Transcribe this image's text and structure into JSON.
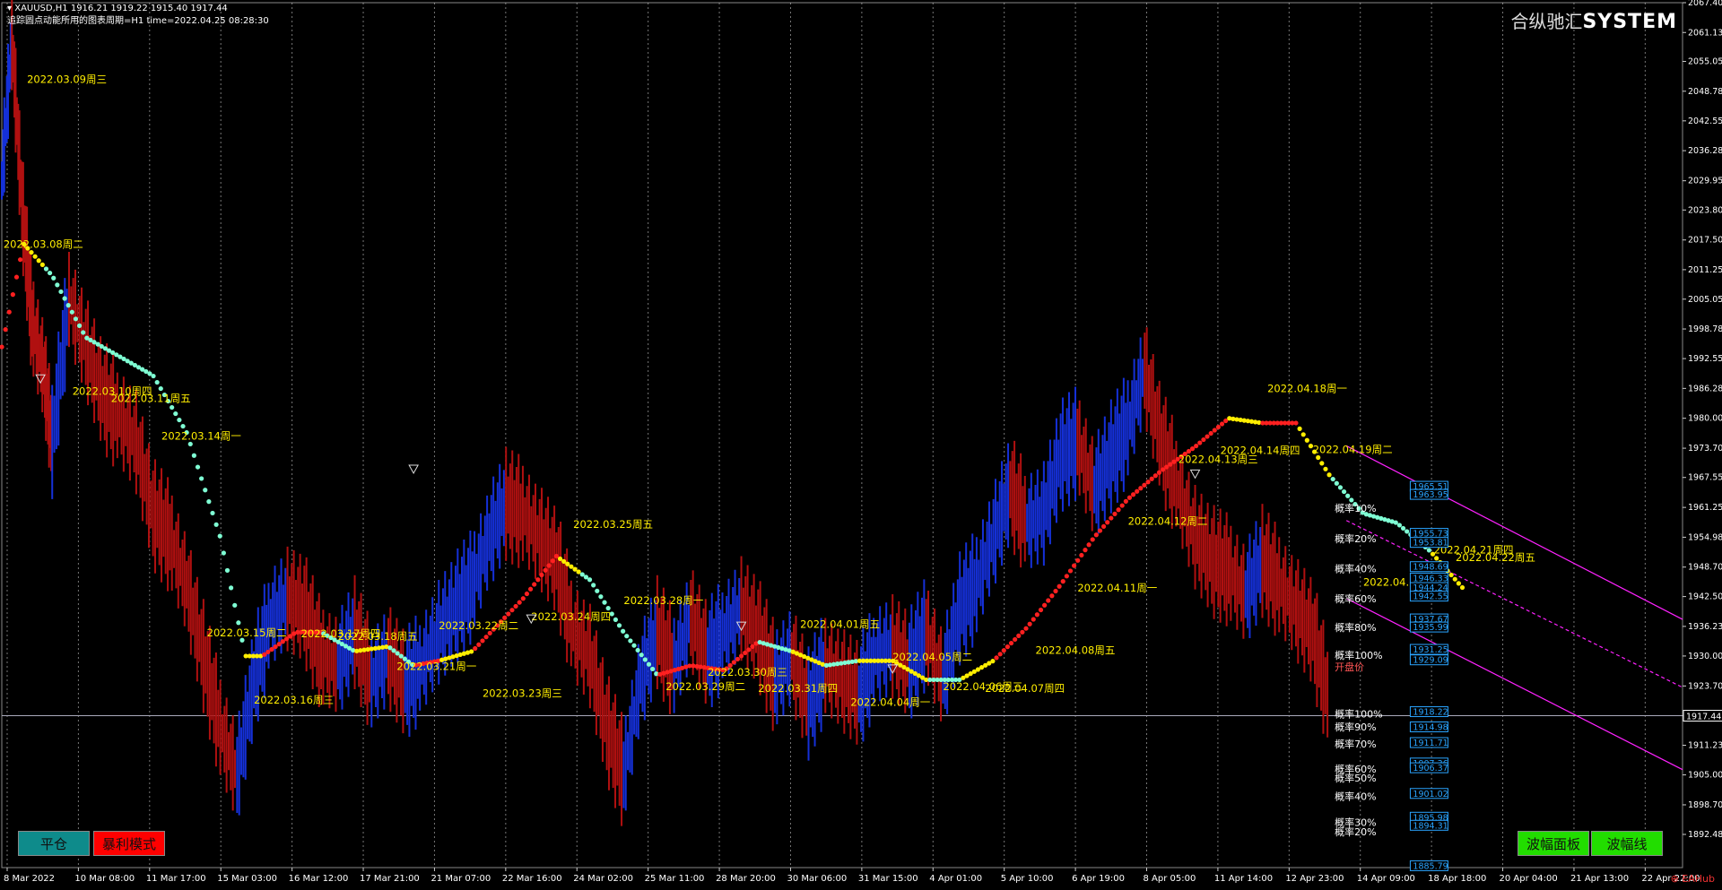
{
  "header": {
    "symbol_line": "XAUUSD,H1  1916.21 1919.22 1915.40 1917.44",
    "info_line": "追踪圆点动能所用的图表周期=H1  time=2022.04.25 08:28:30"
  },
  "brand": {
    "cn": "合纵驰汇",
    "en": "SYSTEM"
  },
  "buttons": {
    "close_position": "平仓",
    "profit_mode": "暴利模式",
    "amplitude_panel": "波幅面板",
    "amplitude_line": "波幅线"
  },
  "watermark": "EAHub",
  "chart_data": {
    "type": "line",
    "ylim": [
      1885.5,
      2067.4
    ],
    "current_price": 1917.44,
    "y_ticks": [
      2067.4,
      2061.13,
      2055.05,
      2048.78,
      2042.55,
      2036.28,
      2029.95,
      2023.8,
      2017.5,
      2011.25,
      2005.05,
      1998.78,
      1992.55,
      1986.28,
      1980.0,
      1973.7,
      1967.55,
      1961.25,
      1954.98,
      1948.7,
      1942.5,
      1936.23,
      1930.0,
      1923.7,
      1917.44,
      1911.23,
      1905.0,
      1898.7,
      1892.48
    ],
    "x_labels": [
      "8 Mar 2022",
      "10 Mar 08:00",
      "11 Mar 17:00",
      "15 Mar 03:00",
      "16 Mar 12:00",
      "17 Mar 21:00",
      "21 Mar 07:00",
      "22 Mar 16:00",
      "24 Mar 02:00",
      "25 Mar 11:00",
      "28 Mar 20:00",
      "30 Mar 06:00",
      "31 Mar 15:00",
      "4 Apr 01:00",
      "5 Apr 10:00",
      "6 Apr 19:00",
      "8 Apr 05:00",
      "11 Apr 14:00",
      "12 Apr 23:00",
      "14 Apr 09:00",
      "18 Apr 18:00",
      "20 Apr 04:00",
      "21 Apr 13:00",
      "22 Apr 22:00"
    ],
    "date_labels": [
      {
        "t": "2022.03.09周三",
        "x": 1.5,
        "y": 2050.5
      },
      {
        "t": "2022.03.08周二",
        "x": 0.1,
        "y": 2015.8
      },
      {
        "t": "2022.03.10周四",
        "x": 4.2,
        "y": 1984.9
      },
      {
        "t": "2022.03.11周五",
        "x": 6.5,
        "y": 1983.4
      },
      {
        "t": "2022.03.14周一",
        "x": 9.5,
        "y": 1975.5
      },
      {
        "t": "2022.03.15周二",
        "x": 12.2,
        "y": 1934.1
      },
      {
        "t": "2022.03.16周三",
        "x": 15.0,
        "y": 1920.0
      },
      {
        "t": "2022.03.17周四",
        "x": 17.8,
        "y": 1933.9
      },
      {
        "t": "2022.03.18周五",
        "x": 20.0,
        "y": 1933.4
      },
      {
        "t": "2022.03.21周一",
        "x": 23.5,
        "y": 1927.1
      },
      {
        "t": "2022.03.22周二",
        "x": 26.0,
        "y": 1935.6
      },
      {
        "t": "2022.03.23周三",
        "x": 28.6,
        "y": 1921.4
      },
      {
        "t": "2022.03.24周四",
        "x": 31.5,
        "y": 1937.5
      },
      {
        "t": "2022.03.25周五",
        "x": 34.0,
        "y": 1956.9
      },
      {
        "t": "2022.03.28周一",
        "x": 37.0,
        "y": 1940.9
      },
      {
        "t": "2022.03.29周二",
        "x": 39.5,
        "y": 1922.8
      },
      {
        "t": "2022.03.30周三",
        "x": 42.0,
        "y": 1925.8
      },
      {
        "t": "2022.03.31周四",
        "x": 45.0,
        "y": 1922.4
      },
      {
        "t": "2022.04.01周五",
        "x": 47.5,
        "y": 1935.9
      },
      {
        "t": "2022.04.04周一",
        "x": 50.5,
        "y": 1919.5
      },
      {
        "t": "2022.04.05周二",
        "x": 53.0,
        "y": 1929.0
      },
      {
        "t": "2022.04.06周三",
        "x": 56.0,
        "y": 1922.8
      },
      {
        "t": "2022.04.07周四",
        "x": 58.5,
        "y": 1922.4
      },
      {
        "t": "2022.04.08周五",
        "x": 61.5,
        "y": 1930.5
      },
      {
        "t": "2022.04.11周一",
        "x": 64.0,
        "y": 1943.6
      },
      {
        "t": "2022.04.12周二",
        "x": 67.0,
        "y": 1957.6
      },
      {
        "t": "2022.04.13周三",
        "x": 70.0,
        "y": 1970.6
      },
      {
        "t": "2022.04.14周四",
        "x": 72.5,
        "y": 1972.5
      },
      {
        "t": "2022.04.18周一",
        "x": 75.3,
        "y": 1985.5
      },
      {
        "t": "2022.04.19周二",
        "x": 78.0,
        "y": 1972.7
      },
      {
        "t": "2022.04.20周三",
        "x": 81.0,
        "y": 1944.8
      },
      {
        "t": "2022.04.21周四",
        "x": 85.2,
        "y": 1951.6
      },
      {
        "t": "2022.04.22周五",
        "x": 86.5,
        "y": 1950.0
      }
    ],
    "level_labels": [
      {
        "t": "概率10%",
        "y": 1960.3
      },
      {
        "t": "概率20%",
        "y": 1953.9
      },
      {
        "t": "概率40%",
        "y": 1947.6
      },
      {
        "t": "概率60%",
        "y": 1941.3
      },
      {
        "t": "概率80%",
        "y": 1935.3
      },
      {
        "t": "概率100%",
        "y": 1929.4
      },
      {
        "t": "开盘价",
        "y": 1927.0
      },
      {
        "t": "概率100%",
        "y": 1917.1
      },
      {
        "t": "概率90%",
        "y": 1914.3
      },
      {
        "t": "概率70%",
        "y": 1910.8
      },
      {
        "t": "概率60%",
        "y": 1905.5
      },
      {
        "t": "概率50%",
        "y": 1903.6
      },
      {
        "t": "概率40%",
        "y": 1899.7
      },
      {
        "t": "概率30%",
        "y": 1894.3
      },
      {
        "t": "概率20%",
        "y": 1892.3
      }
    ],
    "price_tags": [
      "1965.51",
      "1963.95",
      "1955.73",
      "1953.81",
      "1948.69",
      "1946.33",
      "1944.24",
      "1942.55",
      "1937.67",
      "1935.99",
      "1931.25",
      "1929.09",
      "1918.22",
      "1914.98",
      "1911.71",
      "1907.36",
      "1906.37",
      "1901.02",
      "1895.98",
      "1894.31",
      "1885.79"
    ],
    "channel": {
      "start_x": 80,
      "end_x": 100,
      "upper": [
        1974.2,
        1937.7
      ],
      "middle": [
        1958.5,
        1923.4
      ],
      "lower": [
        1942.1,
        1906.1
      ]
    },
    "trend_line": [
      [
        0,
        1995
      ],
      [
        1.3,
        2016.7
      ],
      [
        3,
        2010
      ],
      [
        5,
        1997
      ],
      [
        7,
        1993
      ],
      [
        9,
        1989
      ],
      [
        11,
        1977
      ],
      [
        13,
        1955
      ],
      [
        14.5,
        1930
      ],
      [
        15.5,
        1930
      ],
      [
        17.5,
        1935
      ],
      [
        19,
        1935
      ],
      [
        21,
        1931
      ],
      [
        23,
        1932
      ],
      [
        24.5,
        1928
      ],
      [
        26,
        1929
      ],
      [
        28,
        1931
      ],
      [
        31,
        1942
      ],
      [
        33,
        1951
      ],
      [
        35,
        1946
      ],
      [
        37,
        1935
      ],
      [
        39,
        1926
      ],
      [
        41,
        1928
      ],
      [
        43,
        1927
      ],
      [
        45,
        1933
      ],
      [
        47,
        1931
      ],
      [
        49,
        1928
      ],
      [
        51,
        1929
      ],
      [
        53,
        1929
      ],
      [
        55,
        1925
      ],
      [
        57,
        1925
      ],
      [
        59,
        1929
      ],
      [
        61,
        1936
      ],
      [
        63,
        1945
      ],
      [
        65,
        1955
      ],
      [
        67,
        1963
      ],
      [
        69,
        1969
      ],
      [
        71,
        1974
      ],
      [
        73,
        1980
      ],
      [
        75,
        1979
      ],
      [
        77,
        1979
      ],
      [
        79,
        1968
      ],
      [
        81,
        1960
      ],
      [
        83,
        1958
      ],
      [
        85,
        1952
      ],
      [
        87,
        1944
      ]
    ],
    "trend_colors": [
      [
        "#ff2020",
        0,
        1.3
      ],
      [
        "#ffee00",
        1.3,
        2.5
      ],
      [
        "#7fffd4",
        2.5,
        14.5
      ],
      [
        "#ffee00",
        14.5,
        15.5
      ],
      [
        "#ff2020",
        15.5,
        19
      ],
      [
        "#ffee00",
        21,
        23
      ],
      [
        "#ff2020",
        24.5,
        26
      ],
      [
        "#ffee00",
        26,
        28
      ],
      [
        "#ff2020",
        28,
        33
      ],
      [
        "#ffee00",
        33,
        34.5
      ],
      [
        "#7fffd4",
        34.5,
        39
      ],
      [
        "#ff2020",
        39,
        43
      ],
      [
        "#ff2020",
        43,
        45
      ],
      [
        "#ffee00",
        47,
        49
      ],
      [
        "#ffee00",
        51,
        55
      ],
      [
        "#7fffd4",
        55,
        57
      ],
      [
        "#ffee00",
        57,
        59
      ],
      [
        "#ff2020",
        59,
        73
      ],
      [
        "#ffee00",
        73,
        75
      ],
      [
        "#ff2020",
        75,
        77
      ],
      [
        "#ffee00",
        77,
        79
      ],
      [
        "#7fffd4",
        79,
        85
      ],
      [
        "#ffee00",
        85,
        87
      ]
    ],
    "price_line": [
      [
        0,
        2030
      ],
      [
        0.6,
        2060
      ],
      [
        1.2,
        2025
      ],
      [
        1.8,
        2000
      ],
      [
        2.5,
        1990
      ],
      [
        3,
        1975
      ],
      [
        4,
        2005
      ],
      [
        5,
        1995
      ],
      [
        6,
        1985
      ],
      [
        7,
        1980
      ],
      [
        8,
        1975
      ],
      [
        9,
        1960
      ],
      [
        10,
        1955
      ],
      [
        11,
        1945
      ],
      [
        12,
        1930
      ],
      [
        13,
        1915
      ],
      [
        14,
        1905
      ],
      [
        15,
        1925
      ],
      [
        16,
        1938
      ],
      [
        17,
        1942
      ],
      [
        18,
        1940
      ],
      [
        19,
        1930
      ],
      [
        20,
        1928
      ],
      [
        21,
        1935
      ],
      [
        22,
        1925
      ],
      [
        23,
        1930
      ],
      [
        24,
        1924
      ],
      [
        25,
        1928
      ],
      [
        26,
        1935
      ],
      [
        27,
        1940
      ],
      [
        28,
        1945
      ],
      [
        29,
        1955
      ],
      [
        30,
        1962
      ],
      [
        31,
        1960
      ],
      [
        32,
        1955
      ],
      [
        33,
        1950
      ],
      [
        34,
        1935
      ],
      [
        35,
        1930
      ],
      [
        36,
        1915
      ],
      [
        37,
        1905
      ],
      [
        38,
        1925
      ],
      [
        39,
        1935
      ],
      [
        40,
        1928
      ],
      [
        41,
        1938
      ],
      [
        42,
        1930
      ],
      [
        43,
        1935
      ],
      [
        44,
        1940
      ],
      [
        45,
        1935
      ],
      [
        46,
        1925
      ],
      [
        47,
        1930
      ],
      [
        48,
        1920
      ],
      [
        49,
        1928
      ],
      [
        50,
        1925
      ],
      [
        51,
        1922
      ],
      [
        52,
        1930
      ],
      [
        53,
        1932
      ],
      [
        54,
        1928
      ],
      [
        55,
        1935
      ],
      [
        56,
        1925
      ],
      [
        57,
        1940
      ],
      [
        58,
        1945
      ],
      [
        59,
        1955
      ],
      [
        60,
        1965
      ],
      [
        61,
        1958
      ],
      [
        62,
        1960
      ],
      [
        63,
        1972
      ],
      [
        64,
        1975
      ],
      [
        65,
        1965
      ],
      [
        66,
        1972
      ],
      [
        67,
        1978
      ],
      [
        68,
        1990
      ],
      [
        69,
        1975
      ],
      [
        70,
        1965
      ],
      [
        71,
        1955
      ],
      [
        72,
        1950
      ],
      [
        73,
        1948
      ],
      [
        74,
        1943
      ],
      [
        75,
        1950
      ],
      [
        76,
        1945
      ],
      [
        77,
        1940
      ],
      [
        78,
        1935
      ],
      [
        79,
        1920
      ]
    ],
    "cn_labels_price_label_color": "#ffee00"
  }
}
